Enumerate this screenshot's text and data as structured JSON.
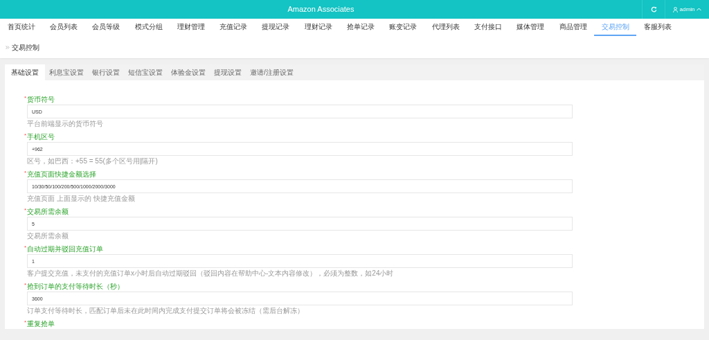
{
  "header": {
    "title": "Amazon Associates",
    "user": "admin"
  },
  "nav": [
    {
      "label": "首页统计",
      "selected": false
    },
    {
      "label": "会员列表",
      "selected": false
    },
    {
      "label": "会员等级",
      "selected": false
    },
    {
      "label": "模式分组",
      "selected": false
    },
    {
      "label": "理财管理",
      "selected": false
    },
    {
      "label": "充值记录",
      "selected": false
    },
    {
      "label": "提现记录",
      "selected": false
    },
    {
      "label": "理财记录",
      "selected": false
    },
    {
      "label": "抢单记录",
      "selected": false
    },
    {
      "label": "账变记录",
      "selected": false
    },
    {
      "label": "代理列表",
      "selected": false
    },
    {
      "label": "支付接口",
      "selected": false
    },
    {
      "label": "媒体管理",
      "selected": false
    },
    {
      "label": "商品管理",
      "selected": false
    },
    {
      "label": "交易控制",
      "selected": true
    },
    {
      "label": "客服列表",
      "selected": false
    }
  ],
  "breadcrumb": "交易控制",
  "tabs": [
    {
      "label": "基础设置",
      "selected": true
    },
    {
      "label": "利息宝设置",
      "selected": false
    },
    {
      "label": "银行设置",
      "selected": false
    },
    {
      "label": "短信宝设置",
      "selected": false
    },
    {
      "label": "体验金设置",
      "selected": false
    },
    {
      "label": "提现设置",
      "selected": false
    },
    {
      "label": "邀请/注册设置",
      "selected": false
    }
  ],
  "fields": [
    {
      "label": "货币符号",
      "required_mark": "*",
      "value": "USD",
      "help": "平台前端显示的货币符号"
    },
    {
      "label": "手机区号",
      "required_mark": "*",
      "value": "+962",
      "help": "区号，如巴西：+55 = 55(多个区号用|隔开)"
    },
    {
      "label": "充值页面快捷金额选择",
      "required_mark": "*",
      "value": "10/30/50/100/200/500/1000/2000/3000",
      "help": "充值页面 上面显示的 快捷充值金额"
    },
    {
      "label": "交易所需余额",
      "required_mark": "*",
      "value": "5",
      "help": "交易所需余额"
    },
    {
      "label": "自动过期并驳回充值订单",
      "required_mark": "*",
      "value": "1",
      "help": "客户提交充值，未支付的充值订单x小时后自动过期驳回（驳回内容在帮助中心-文本内容修改），必须为整数，如24小时"
    },
    {
      "label": "抢到订单的支付等待时长（秒）",
      "required_mark": "*",
      "value": "3600",
      "help": "订单支付等待时长，匹配订单后未在此时间内完成支付提交订单将会被冻结（需后台解冻）"
    },
    {
      "label": "重复抢单",
      "required_mark": "*"
    }
  ]
}
